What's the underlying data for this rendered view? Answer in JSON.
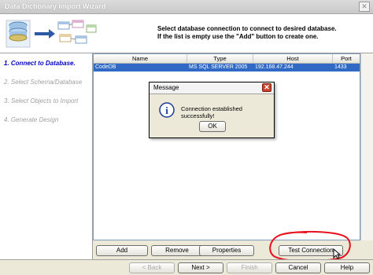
{
  "window": {
    "title": "Data Dictionary Import Wizard",
    "close_glyph": "✕"
  },
  "header": {
    "line1": "Select database connection to connect to desired database.",
    "line2": "If the list is empty use the \"Add\" button to create one."
  },
  "steps": [
    {
      "label": "1. Connect to Database.",
      "active": true
    },
    {
      "label": "2. Select Schema/Database",
      "active": false
    },
    {
      "label": "3. Select Objects to Import",
      "active": false
    },
    {
      "label": "4. Generate Design",
      "active": false
    }
  ],
  "grid": {
    "columns": [
      "Name",
      "Type",
      "Host",
      "Port"
    ],
    "rows": [
      {
        "name": "CodeDB",
        "type": "MS SQL SERVER 2005",
        "host": "192.168.47.244",
        "port": "1433",
        "selected": true
      }
    ]
  },
  "buttons": {
    "add": "Add",
    "remove": "Remove",
    "properties": "Properties",
    "test_connection": "Test Connection"
  },
  "footer": {
    "back": "< Back",
    "next": "Next >",
    "finish": "Finish",
    "cancel": "Cancel",
    "help": "Help"
  },
  "dialog": {
    "title": "Message",
    "message": "Connection established successfully!",
    "ok": "OK",
    "close_glyph": "✕",
    "icon_glyph": "i"
  },
  "colors": {
    "selection": "#316ac5",
    "active_step": "#0000c0",
    "annotation_circle": "#e8101a"
  }
}
